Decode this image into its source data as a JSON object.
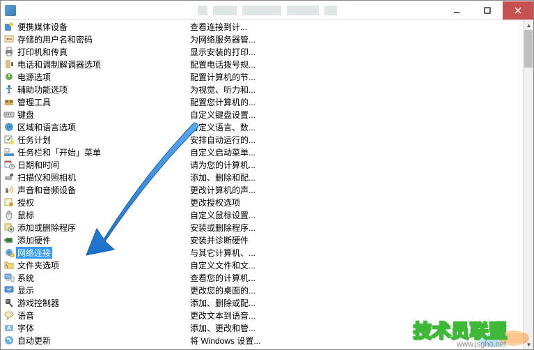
{
  "window": {
    "min_icon": "minimize",
    "max_icon": "maximize",
    "close_icon": "close"
  },
  "selected_index": 18,
  "items": [
    {
      "icon": "portable-media",
      "name": "便携媒体设备",
      "desc": "查看连接到计..."
    },
    {
      "icon": "password",
      "name": "存储的用户名和密码",
      "desc": "为网络服务器管..."
    },
    {
      "icon": "printer",
      "name": "打印机和传真",
      "desc": "显示安装的打印..."
    },
    {
      "icon": "phone",
      "name": "电话和调制解调器选项",
      "desc": "配置电话拨号规..."
    },
    {
      "icon": "power",
      "name": "电源选项",
      "desc": "配置计算机的节..."
    },
    {
      "icon": "accessibility",
      "name": "辅助功能选项",
      "desc": "为视觉、听力和..."
    },
    {
      "icon": "admin",
      "name": "管理工具",
      "desc": "配置您计算机的..."
    },
    {
      "icon": "keyboard",
      "name": "键盘",
      "desc": "自定义键盘设置..."
    },
    {
      "icon": "region",
      "name": "区域和语言选项",
      "desc": "自定义语言、数..."
    },
    {
      "icon": "task",
      "name": "任务计划",
      "desc": "安排自动运行的..."
    },
    {
      "icon": "taskbar",
      "name": "任务栏和「开始」菜单",
      "desc": "自定义启动菜单..."
    },
    {
      "icon": "datetime",
      "name": "日期和时间",
      "desc": "请为您的计算机..."
    },
    {
      "icon": "scanner",
      "name": "扫描仪和照相机",
      "desc": "添加、删除和配..."
    },
    {
      "icon": "sound",
      "name": "声音和音频设备",
      "desc": "更改计算机的声..."
    },
    {
      "icon": "license",
      "name": "授权",
      "desc": "更改授权选项"
    },
    {
      "icon": "mouse",
      "name": "鼠标",
      "desc": "自定义鼠标设置..."
    },
    {
      "icon": "programs",
      "name": "添加或删除程序",
      "desc": "安装或删除程序..."
    },
    {
      "icon": "hardware",
      "name": "添加硬件",
      "desc": "安装并诊断硬件"
    },
    {
      "icon": "network",
      "name": "网络连接",
      "desc": "与其它计算机、..."
    },
    {
      "icon": "folder",
      "name": "文件夹选项",
      "desc": "自定义文件和文..."
    },
    {
      "icon": "system",
      "name": "系统",
      "desc": "查看您的计算机..."
    },
    {
      "icon": "display",
      "name": "显示",
      "desc": "更改您的桌面的..."
    },
    {
      "icon": "game",
      "name": "游戏控制器",
      "desc": "添加、删除或配..."
    },
    {
      "icon": "speech",
      "name": "语音",
      "desc": "更改文本到语音..."
    },
    {
      "icon": "font",
      "name": "字体",
      "desc": "添加、更改和管..."
    },
    {
      "icon": "update",
      "name": "自动更新",
      "desc": "将 Windows 设置..."
    }
  ],
  "watermark": {
    "logo_text": "技术员联盟",
    "url": "www.jsgho.net"
  }
}
